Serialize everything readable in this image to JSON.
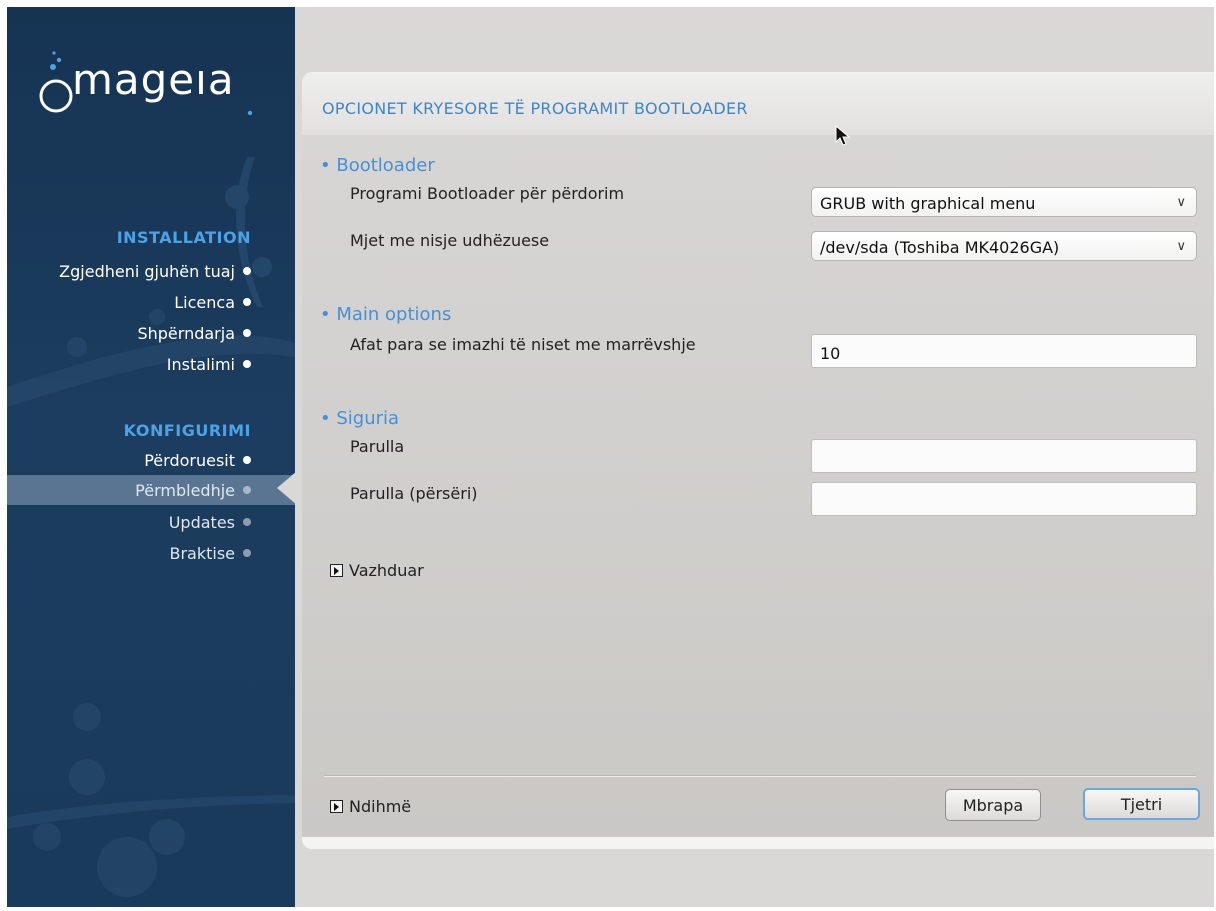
{
  "brand": {
    "logo_text": "mageıa"
  },
  "sidebar": {
    "sections": [
      {
        "title": "INSTALLATION"
      },
      {
        "title": "KONFIGURIMI"
      }
    ],
    "installation_items": [
      {
        "label": "Zgjedheni gjuhën tuaj"
      },
      {
        "label": "Licenca"
      },
      {
        "label": "Shpërndarja"
      },
      {
        "label": "Instalimi"
      }
    ],
    "config_items": [
      {
        "label": "Përdoruesit"
      },
      {
        "label": "Përmbledhje",
        "active": true
      },
      {
        "label": "Updates"
      },
      {
        "label": "Braktise"
      }
    ]
  },
  "page": {
    "title": "OPCIONET KRYESORE TË PROGRAMIT BOOTLOADER",
    "groups": {
      "bootloader": {
        "heading": "• Bootloader",
        "bootloader_label": "Programi Bootloader për përdorim",
        "bootloader_value": "GRUB with graphical menu",
        "device_label": "Mjet me nisje udhëzuese",
        "device_value": "/dev/sda (Toshiba MK4026GA)"
      },
      "main_options": {
        "heading": "• Main options",
        "timeout_label": "Afat para se imazhi të niset me marrëvshje",
        "timeout_value": "10"
      },
      "security": {
        "heading": "• Siguria",
        "password_label": "Parulla",
        "password_value": "",
        "password_again_label": "Parulla (përsëri)",
        "password_again_value": ""
      }
    },
    "advanced_label": "Vazhduar",
    "help_label": "Ndihmë",
    "back_label": "Mbrapa",
    "next_label": "Tjetri"
  },
  "colors": {
    "sidebar_bg": "#1a3a5b",
    "section_heading": "#4aa3e8",
    "page_title": "#3f86c9",
    "panel_bg": "#d9d8d6"
  }
}
